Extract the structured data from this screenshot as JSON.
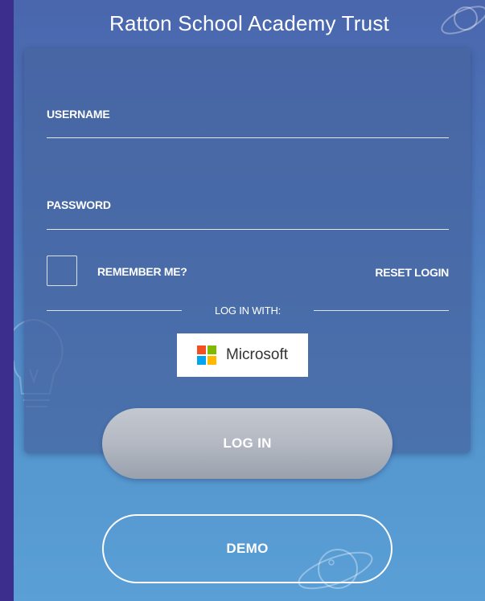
{
  "header": {
    "title": "Ratton School Academy Trust"
  },
  "login_form": {
    "username_label": "USERNAME",
    "username_value": "",
    "password_label": "PASSWORD",
    "password_value": "",
    "remember_me_label": "REMEMBER ME?",
    "remember_me_checked": false,
    "reset_login_label": "RESET LOGIN",
    "divider_text": "LOG IN WITH:",
    "microsoft_label": "Microsoft",
    "login_label": "LOG IN",
    "demo_label": "DEMO"
  },
  "icons": {
    "microsoft_logo": "microsoft-logo-icon",
    "decorations": [
      "planet-icon",
      "lightbulb-icon",
      "planet-icon"
    ]
  },
  "colors": {
    "background_outer": "#3d2f8f",
    "panel_top": "#4a66ad",
    "panel_bottom": "#5a9fd6",
    "microsoft_red": "#f25022",
    "microsoft_green": "#7fba00",
    "microsoft_blue": "#00a4ef",
    "microsoft_yellow": "#ffb900"
  }
}
